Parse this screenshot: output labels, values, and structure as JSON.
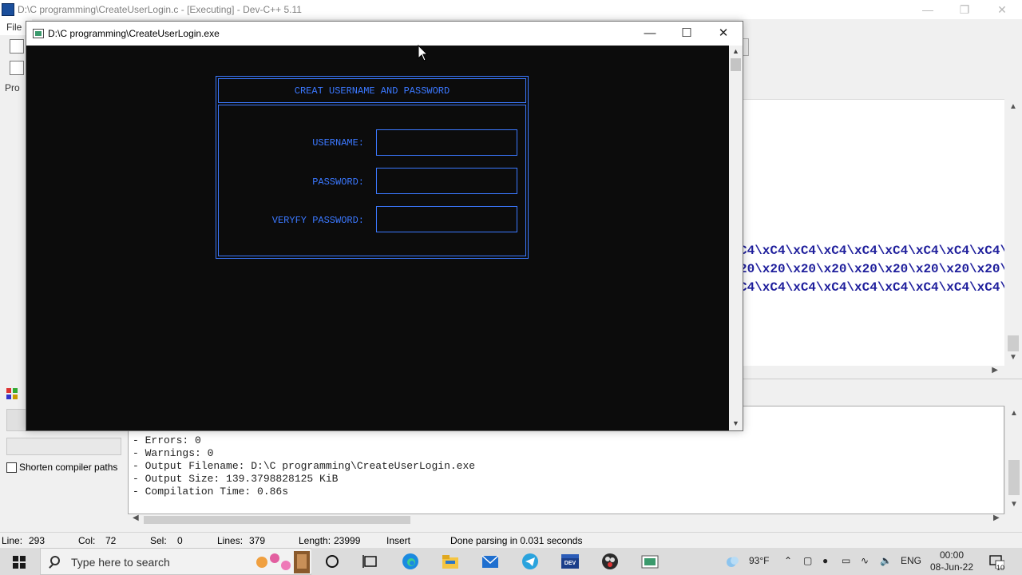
{
  "ide": {
    "title": "D:\\C programming\\CreateUserLogin.c - [Executing] - Dev-C++ 5.11",
    "menu_file": "File",
    "project_tab": "Pro",
    "shorten_paths_label": "Shorten compiler paths",
    "code_lines": [
      "C4\\xC4\\xC4\\xC4\\xC4\\xC4\\xC4\\xC4\\xC4\\xC4\\xC4",
      "20\\x20\\x20\\x20\\x20\\x20\\x20\\x20\\x20\\x20",
      "C4\\xC4\\xC4\\xC4\\xC4\\xC4\\xC4\\xC4\\xC4\\xC4"
    ],
    "log": {
      "errors": "- Errors: 0",
      "warnings": "- Warnings: 0",
      "output_filename": "- Output Filename: D:\\C programming\\CreateUserLogin.exe",
      "output_size": "- Output Size: 139.3798828125 KiB",
      "compilation_time": "- Compilation Time: 0.86s"
    },
    "status": {
      "line_label": "Line:",
      "line_value": "293",
      "col_label": "Col:",
      "col_value": "72",
      "sel_label": "Sel:",
      "sel_value": "0",
      "lines_label": "Lines:",
      "lines_value": "379",
      "length_label": "Length:",
      "length_value": "23999",
      "mode": "Insert",
      "message": "Done parsing in 0.031 seconds"
    }
  },
  "console": {
    "title": "D:\\C programming\\CreateUserLogin.exe",
    "header": "CREAT USERNAME AND PASSWORD",
    "username_label": "USERNAME:",
    "password_label": "PASSWORD:",
    "verify_label": "VERYFY PASSWORD:",
    "username_value": "",
    "password_value": "",
    "verify_value": ""
  },
  "taskbar": {
    "search_placeholder": "Type here to search",
    "weather": "93°F",
    "language": "ENG",
    "time": "00:00",
    "date": "08-Jun-22",
    "notification_count": "10"
  },
  "colors": {
    "console_bg": "#0c0c0c",
    "console_text": "#3b78ff",
    "code_text": "#1f1f9c"
  }
}
